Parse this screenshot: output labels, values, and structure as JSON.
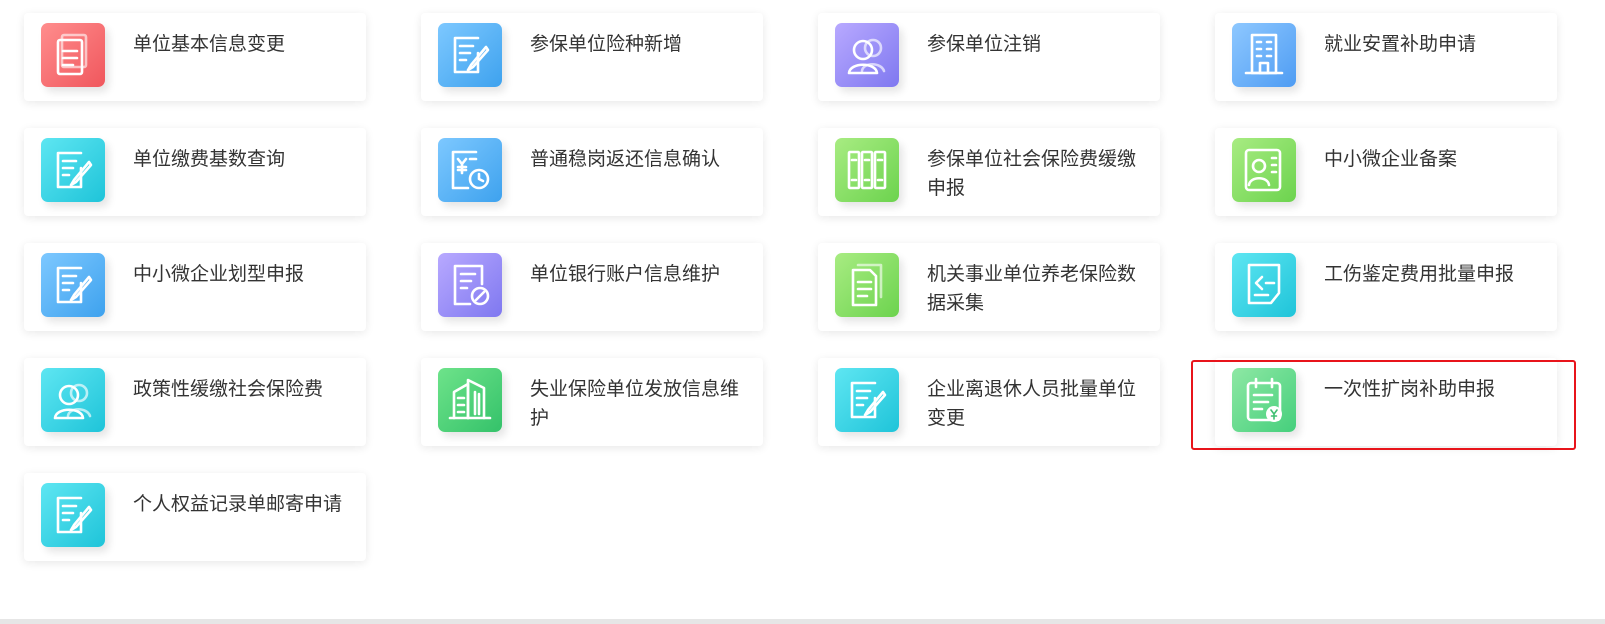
{
  "colors": {
    "highlight_border": "#e8141b",
    "label_text": "#333333",
    "card_background": "#ffffff"
  },
  "services": [
    {
      "label": "单位基本信息变更",
      "icon": "document-icon",
      "colors": [
        "#ff8d8d",
        "#f0575d"
      ]
    },
    {
      "label": "参保单位险种新增",
      "icon": "edit-form-icon",
      "colors": [
        "#7dc8ff",
        "#3ea2ee"
      ]
    },
    {
      "label": "参保单位注销",
      "icon": "users-icon",
      "colors": [
        "#b8a9ff",
        "#7f78f0"
      ]
    },
    {
      "label": "就业安置补助申请",
      "icon": "building-icon",
      "colors": [
        "#8ec8ff",
        "#4e9cf3"
      ]
    },
    {
      "label": "单位缴费基数查询",
      "icon": "edit-form-icon",
      "colors": [
        "#5ee6f2",
        "#1fc4d9"
      ]
    },
    {
      "label": "普通稳岗返还信息确认",
      "icon": "money-clock-icon",
      "colors": [
        "#7dc8ff",
        "#3ea2ee"
      ]
    },
    {
      "label": "参保单位社会保险费缓缴申报",
      "icon": "binders-icon",
      "colors": [
        "#a8ec82",
        "#6cd34e"
      ]
    },
    {
      "label": "中小微企业备案",
      "icon": "id-card-icon",
      "colors": [
        "#a8ec82",
        "#6cd34e"
      ]
    },
    {
      "label": "中小微企业划型申报",
      "icon": "edit-form-icon",
      "colors": [
        "#7dc8ff",
        "#3ea2ee"
      ]
    },
    {
      "label": "单位银行账户信息维护",
      "icon": "form-edit-icon",
      "colors": [
        "#b8a9ff",
        "#7f78f0"
      ]
    },
    {
      "label": "机关事业单位养老保险数据采集",
      "icon": "stacked-docs-icon",
      "colors": [
        "#a8ec82",
        "#6cd34e"
      ]
    },
    {
      "label": "工伤鉴定费用批量申报",
      "icon": "note-icon",
      "colors": [
        "#5ee6f2",
        "#1fc4d9"
      ]
    },
    {
      "label": "政策性缓缴社会保险费",
      "icon": "users-icon",
      "colors": [
        "#5ee6f2",
        "#1fc4d9"
      ]
    },
    {
      "label": "失业保险单位发放信息维护",
      "icon": "office-building-icon",
      "colors": [
        "#6ee38a",
        "#34c26a"
      ]
    },
    {
      "label": "企业离退休人员批量单位变更",
      "icon": "edit-form-icon",
      "colors": [
        "#5ee6f2",
        "#1fc4d9"
      ]
    },
    {
      "label": "一次性扩岗补助申报",
      "icon": "clipboard-yen-icon",
      "colors": [
        "#8ee8a4",
        "#45cf7c"
      ],
      "highlighted": true
    },
    {
      "label": "个人权益记录单邮寄申请",
      "icon": "edit-form-icon",
      "colors": [
        "#5ee6f2",
        "#1fc4d9"
      ]
    }
  ]
}
